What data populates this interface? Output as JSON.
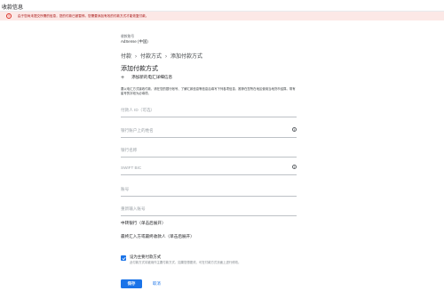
{
  "header": {
    "title": "收款信息"
  },
  "alert": {
    "icon": "error-icon",
    "text": "由于您尚未提交所需的信息，您的付款已被暂停。您需要添加有效的付款方式才能恢复付款。"
  },
  "account": {
    "label": "收款账号",
    "value": "AdSense (中国)"
  },
  "breadcrumb": [
    "付款",
    "付款方式",
    "添加付款方式"
  ],
  "section_title": "添加付款方式",
  "add_details": {
    "icon": "plus-icon",
    "label": "添加新的电汇详细信息"
  },
  "description": "要以电汇方式接收付款，请在您的银行帐号、了解汇款信息等信息后填写下列各项信息，推荐在您所在地区使用当地货币结算。带有星号的字段为必填项。",
  "fields": [
    {
      "placeholder": "付款人 ID（可选）",
      "info": false
    },
    {
      "placeholder": "银行账户上的姓名",
      "info": true
    },
    {
      "placeholder": "银行名称",
      "info": false
    },
    {
      "placeholder": "SWIFT BIC",
      "info": true
    },
    {
      "placeholder": "账号",
      "info": false
    },
    {
      "placeholder": "重新输入账号",
      "info": false
    }
  ],
  "intermediary": {
    "bank": "中转银行（单击后展开）",
    "beneficiary": "最终汇入方或最终收款人（单击后展开）"
  },
  "primary_checkbox": {
    "checked": true,
    "label": "设为主要付款方式",
    "help": "此付款方式将被用作主要付款方式，如果您想更改，可在付款方式页面上进行修改。"
  },
  "buttons": {
    "save": "保存",
    "cancel": "取消"
  },
  "colors": {
    "accent": "#1a73e8",
    "alert_bg": "#fce8e6",
    "alert_fg": "#d93025"
  }
}
